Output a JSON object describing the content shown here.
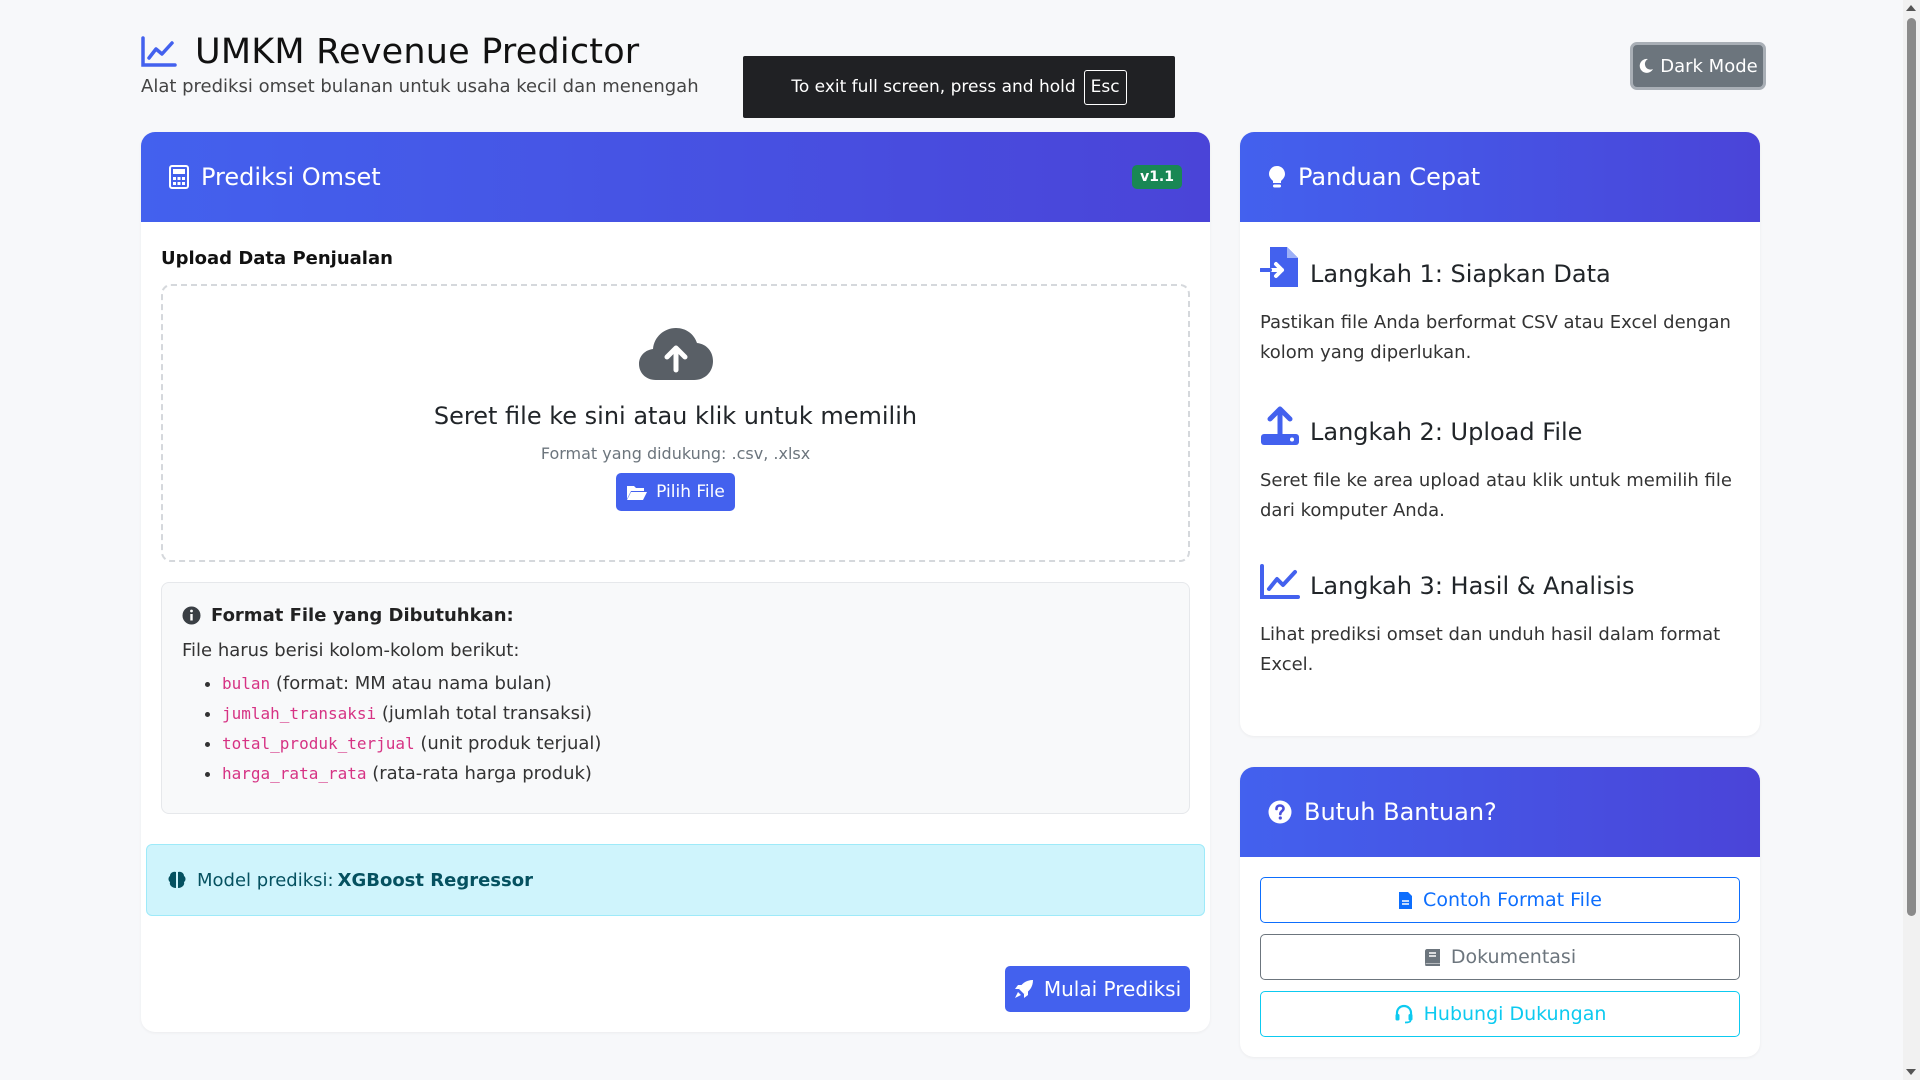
{
  "header": {
    "title": "UMKM Revenue Predictor",
    "subtitle": "Alat prediksi omset bulanan untuk usaha kecil dan menengah",
    "icon": "chart-line-icon"
  },
  "fullscreen_toast": {
    "text": "To exit full screen, press and hold",
    "key": "Esc"
  },
  "dark_mode_button": {
    "label": "Dark Mode",
    "icon": "moon-icon"
  },
  "predict_card": {
    "title": "Prediksi Omset",
    "icon": "calculator-icon",
    "version_badge": "v1.1",
    "upload_label": "Upload Data Penjualan",
    "dropzone": {
      "icon": "cloud-upload-icon",
      "title": "Seret file ke sini atau klik untuk memilih",
      "formats": "Format yang didukung: .csv, .xlsx",
      "button_label": "Pilih File",
      "button_icon": "folder-open-icon"
    },
    "format_box": {
      "title": "Format File yang Dibutuhkan:",
      "intro": "File harus berisi kolom-kolom berikut:",
      "columns": [
        {
          "code": "bulan",
          "desc": " (format: MM atau nama bulan)"
        },
        {
          "code": "jumlah_transaksi",
          "desc": " (jumlah total transaksi)"
        },
        {
          "code": "total_produk_terjual",
          "desc": " (unit produk terjual)"
        },
        {
          "code": "harga_rata_rata",
          "desc": " (rata-rata harga produk)"
        }
      ]
    },
    "model": {
      "label": "Model prediksi: ",
      "name": "XGBoost Regressor",
      "icon": "brain-icon"
    },
    "start_button": {
      "label": "Mulai Prediksi",
      "icon": "rocket-icon"
    }
  },
  "guide_card": {
    "title": "Panduan Cepat",
    "icon": "lightbulb-icon",
    "steps": [
      {
        "title": "Langkah 1: Siapkan Data",
        "desc": "Pastikan file Anda berformat CSV atau Excel dengan kolom yang diperlukan.",
        "icon": "file-import-icon"
      },
      {
        "title": "Langkah 2: Upload File",
        "desc": "Seret file ke area upload atau klik untuk memilih file dari komputer Anda.",
        "icon": "upload-icon"
      },
      {
        "title": "Langkah 3: Hasil & Analisis",
        "desc": "Lihat prediksi omset dan unduh hasil dalam format Excel.",
        "icon": "chart-line-icon"
      }
    ]
  },
  "help_card": {
    "title": "Butuh Bantuan?",
    "icon": "question-circle-icon",
    "buttons": [
      {
        "label": "Contoh Format File",
        "icon": "file-icon"
      },
      {
        "label": "Dokumentasi",
        "icon": "book-icon"
      },
      {
        "label": "Hubungi Dukungan",
        "icon": "headset-icon"
      }
    ]
  },
  "colors": {
    "primary": "#4361ee",
    "header_gradient_end": "#4a44d8",
    "success_badge": "#198754",
    "info_bg": "#cff4fc",
    "code": "#d63384"
  }
}
